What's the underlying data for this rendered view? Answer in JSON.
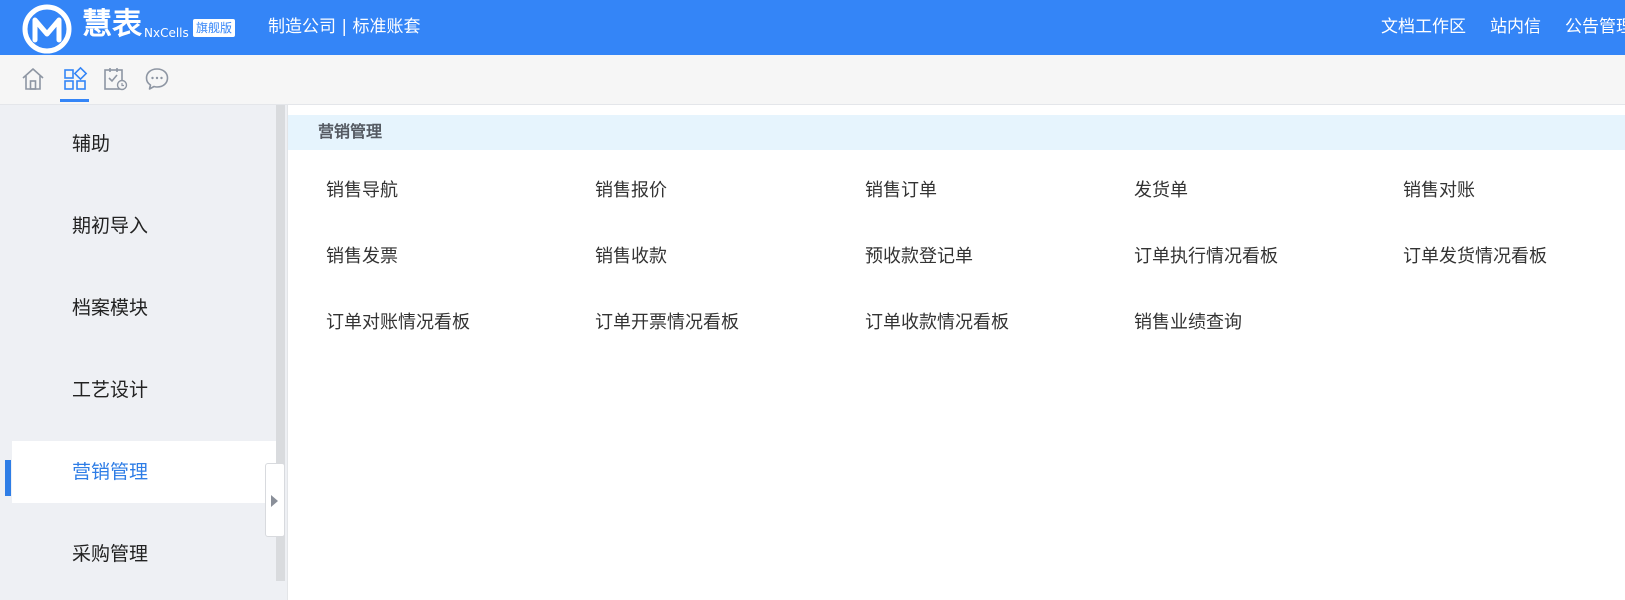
{
  "header": {
    "brand_name": "慧表",
    "brand_sub": "NxCells",
    "edition": "旗舰版",
    "company": "制造公司 | 标准账套",
    "links": [
      "文档工作区",
      "站内信",
      "公告管理"
    ]
  },
  "toolbar": {
    "icons": [
      "home-icon",
      "apps-grid-icon",
      "calendar-check-icon",
      "chat-bubble-icon"
    ],
    "active_index": 1
  },
  "sidebar": {
    "items": [
      {
        "label": "辅助"
      },
      {
        "label": "期初导入"
      },
      {
        "label": "档案模块"
      },
      {
        "label": "工艺设计"
      },
      {
        "label": "营销管理"
      },
      {
        "label": "采购管理"
      }
    ],
    "active_index": 4
  },
  "main": {
    "section_title": "营销管理",
    "modules": [
      [
        "销售导航",
        "销售报价",
        "销售订单",
        "发货单",
        "销售对账"
      ],
      [
        "销售发票",
        "销售收款",
        "预收款登记单",
        "订单执行情况看板",
        "订单发货情况看板"
      ],
      [
        "订单对账情况看板",
        "订单开票情况看板",
        "订单收款情况看板",
        "销售业绩查询"
      ]
    ]
  },
  "colors": {
    "primary": "#3485f7",
    "active_text": "#2e7de6",
    "section_header_bg": "#e6f4fd",
    "sidebar_bg": "#eef0f4"
  }
}
